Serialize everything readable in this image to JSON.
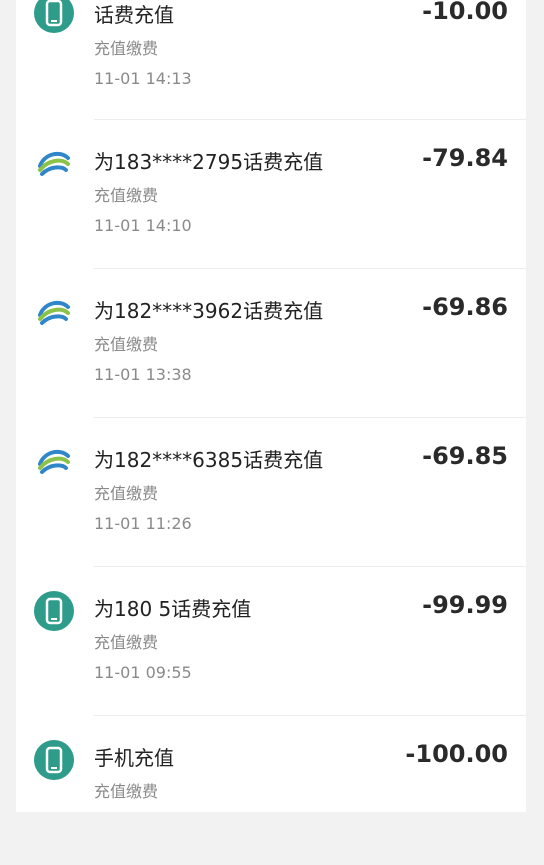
{
  "transactions": [
    {
      "title": "话费充值",
      "category": "充值缴费",
      "time": "11-01 14:13",
      "amount": "-10.00",
      "icon": "phone-icon"
    },
    {
      "title": "为183****2795话费充值",
      "category": "充值缴费",
      "time": "11-01 14:10",
      "amount": "-79.84",
      "icon": "china-mobile-logo-icon"
    },
    {
      "title": "为182****3962话费充值",
      "category": "充值缴费",
      "time": "11-01 13:38",
      "amount": "-69.86",
      "icon": "china-mobile-logo-icon"
    },
    {
      "title": "为182****6385话费充值",
      "category": "充值缴费",
      "time": "11-01 11:26",
      "amount": "-69.85",
      "icon": "china-mobile-logo-icon"
    },
    {
      "title": "为180          5话费充值",
      "category": "充值缴费",
      "time": "11-01 09:55",
      "amount": "-99.99",
      "icon": "phone-icon"
    },
    {
      "title": "手机充值",
      "category": "充值缴费",
      "time": "",
      "amount": "-100.00",
      "icon": "phone-icon"
    }
  ],
  "colors": {
    "phone_icon_bg": "#2f9b8b",
    "mobile_logo_blue": "#2f86c8",
    "mobile_logo_green": "#8bc34a"
  }
}
